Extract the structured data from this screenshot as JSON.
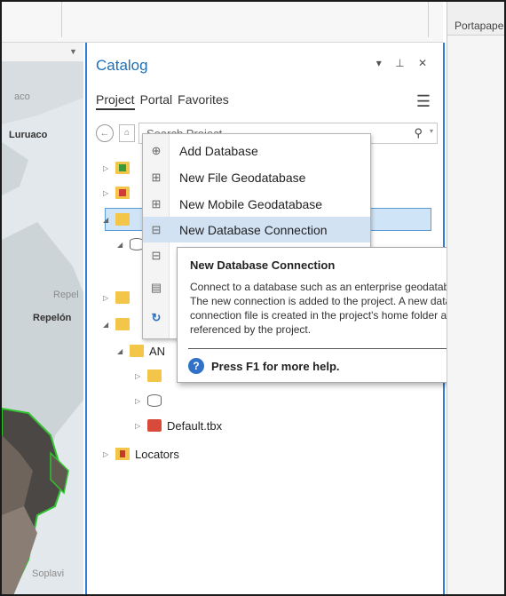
{
  "right_pane": {
    "label": "Portapape"
  },
  "map": {
    "labels": [
      {
        "text": "aco",
        "style": "light"
      },
      {
        "text": "Luruaco",
        "style": "dark"
      },
      {
        "text": "Repel",
        "style": "light"
      },
      {
        "text": "Repelón",
        "style": "dark"
      },
      {
        "text": "Soplavi",
        "style": "light"
      }
    ]
  },
  "catalog": {
    "title": "Catalog",
    "controls": "▾ ⊥ ✕",
    "tabs": [
      "Project",
      "Portal",
      "Favorites"
    ],
    "search_placeholder": "Search Project",
    "tree": {
      "anchor_label": "AN",
      "toolbox_label": "Default.tbx",
      "locators_label": "Locators"
    }
  },
  "context_menu": {
    "items": [
      {
        "label": "Add Database",
        "icon": "add-database-icon"
      },
      {
        "label": "New File Geodatabase",
        "icon": "file-geodatabase-icon"
      },
      {
        "label": "New Mobile Geodatabase",
        "icon": "mobile-geodatabase-icon"
      },
      {
        "label": "New Database Connection",
        "icon": "database-connection-icon",
        "highlighted": true
      }
    ]
  },
  "tooltip": {
    "title": "New Database Connection",
    "body": "Connect to a database such as an enterprise geodatabase. The new connection is added to the project. A new database connection file is created in the project's home folder and is referenced by the project.",
    "help": "Press F1 for more help."
  }
}
